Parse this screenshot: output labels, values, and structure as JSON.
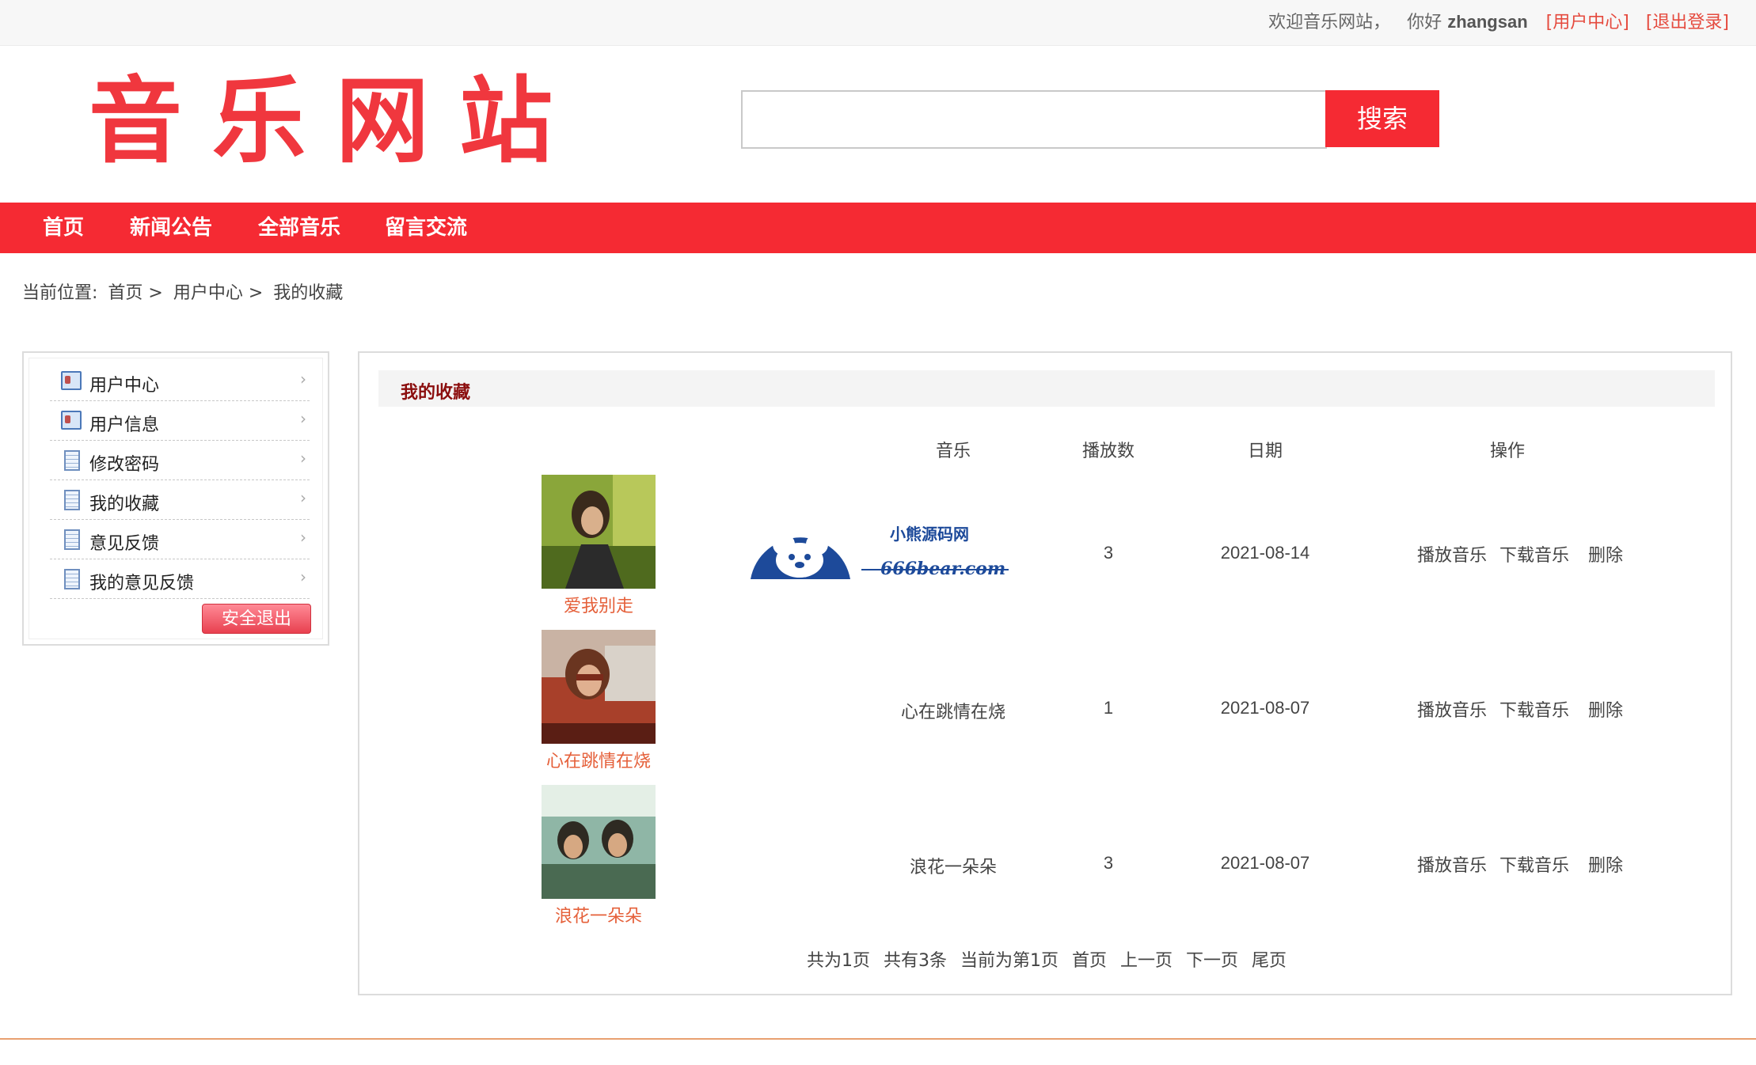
{
  "topbar": {
    "welcome": "欢迎音乐网站，",
    "hello": "你好",
    "username": "zhangsan",
    "user_center_link": "[用户中心]",
    "logout_link": "[退出登录]"
  },
  "header": {
    "logo_text": "音乐网站",
    "search": {
      "value": "",
      "placeholder": "",
      "button_label": "搜索"
    }
  },
  "nav": {
    "items": [
      {
        "label": "首页"
      },
      {
        "label": "新闻公告"
      },
      {
        "label": "全部音乐"
      },
      {
        "label": "留言交流"
      }
    ]
  },
  "breadcrumb": {
    "prefix": "当前位置:",
    "items": [
      "首页 >",
      "用户中心 >",
      "我的收藏"
    ]
  },
  "sidebar": {
    "items": [
      {
        "label": "用户中心",
        "icon": "user-card-icon"
      },
      {
        "label": "用户信息",
        "icon": "user-card-icon"
      },
      {
        "label": "修改密码",
        "icon": "document-icon"
      },
      {
        "label": "我的收藏",
        "icon": "document-icon"
      },
      {
        "label": "意见反馈",
        "icon": "document-icon"
      },
      {
        "label": "我的意见反馈",
        "icon": "document-icon"
      }
    ],
    "arrow_glyph": "›",
    "logout_button": "安全退出"
  },
  "main": {
    "title": "我的收藏",
    "columns": {
      "music": "音乐",
      "plays": "播放数",
      "date": "日期",
      "actions": "操作"
    },
    "rows": [
      {
        "title": "爱我别走",
        "music": "",
        "plays": "3",
        "date": "2021-08-14"
      },
      {
        "title": "心在跳情在烧",
        "music": "心在跳情在烧",
        "plays": "1",
        "date": "2021-08-07"
      },
      {
        "title": "浪花一朵朵",
        "music": "浪花一朵朵",
        "plays": "3",
        "date": "2021-08-07"
      }
    ],
    "actions": {
      "play": "播放音乐",
      "download": "下载音乐",
      "delete": "删除"
    },
    "watermark": {
      "line1": "小熊源码网",
      "line2": "666bear.com"
    },
    "pager": {
      "total_pages": "共为1页",
      "total_items": "共有3条",
      "current": "当前为第1页",
      "first": "首页",
      "prev": "上一页",
      "next": "下一页",
      "last": "尾页"
    }
  },
  "colors": {
    "brand_red": "#f52a33",
    "logo_red": "#f0373e",
    "link_orange": "#e5603a",
    "title_dark_red": "#8b0e0e"
  }
}
